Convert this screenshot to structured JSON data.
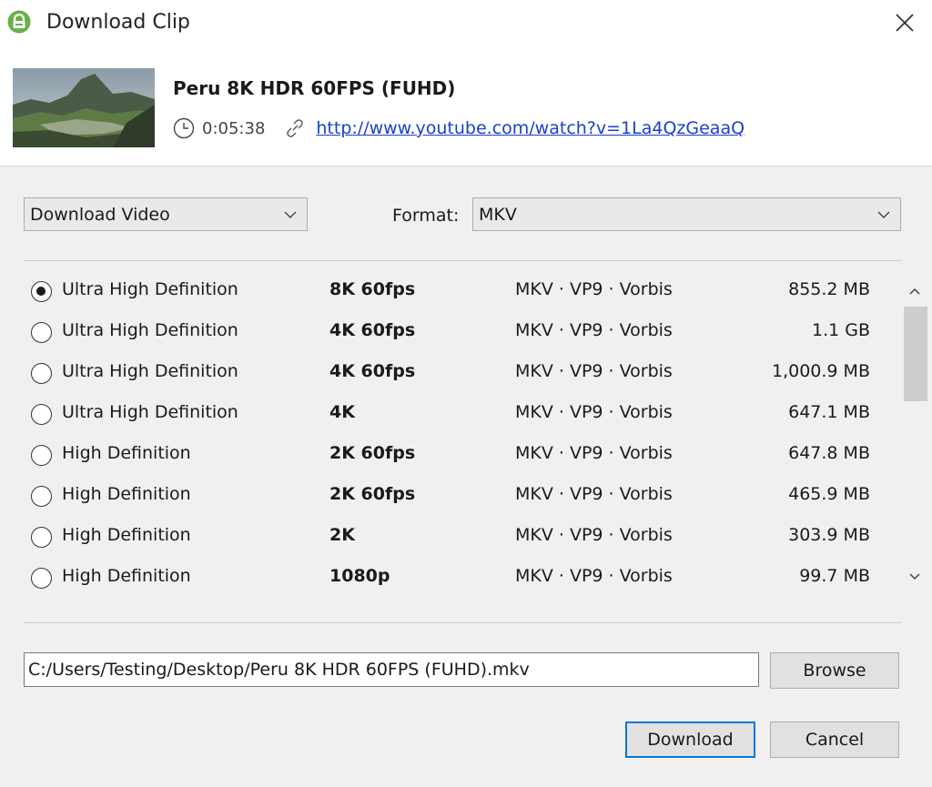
{
  "window": {
    "title": "Download Clip"
  },
  "video": {
    "title": "Peru 8K HDR 60FPS (FUHD)",
    "duration": "0:05:38",
    "url": "http://www.youtube.com/watch?v=1La4QzGeaaQ"
  },
  "controls": {
    "mode_selected": "Download Video",
    "format_label": "Format:",
    "format_selected": "MKV"
  },
  "streams": [
    {
      "quality": "Ultra High Definition",
      "resolution": "8K 60fps",
      "codec": "MKV · VP9 · Vorbis",
      "size": "855.2 MB",
      "selected": true
    },
    {
      "quality": "Ultra High Definition",
      "resolution": "4K 60fps",
      "codec": "MKV · VP9 · Vorbis",
      "size": "1.1 GB",
      "selected": false
    },
    {
      "quality": "Ultra High Definition",
      "resolution": "4K 60fps",
      "codec": "MKV · VP9 · Vorbis",
      "size": "1,000.9 MB",
      "selected": false
    },
    {
      "quality": "Ultra High Definition",
      "resolution": "4K",
      "codec": "MKV · VP9 · Vorbis",
      "size": "647.1 MB",
      "selected": false
    },
    {
      "quality": "High Definition",
      "resolution": "2K 60fps",
      "codec": "MKV · VP9 · Vorbis",
      "size": "647.8 MB",
      "selected": false
    },
    {
      "quality": "High Definition",
      "resolution": "2K 60fps",
      "codec": "MKV · VP9 · Vorbis",
      "size": "465.9 MB",
      "selected": false
    },
    {
      "quality": "High Definition",
      "resolution": "2K",
      "codec": "MKV · VP9 · Vorbis",
      "size": "303.9 MB",
      "selected": false
    },
    {
      "quality": "High Definition",
      "resolution": "1080p",
      "codec": "MKV · VP9 · Vorbis",
      "size": "99.7 MB",
      "selected": false
    }
  ],
  "output": {
    "path": "C:/Users/Testing/Desktop/Peru 8K HDR 60FPS (FUHD).mkv",
    "browse_label": "Browse"
  },
  "actions": {
    "download_label": "Download",
    "cancel_label": "Cancel"
  },
  "colors": {
    "app_icon": "#6ab04c",
    "link": "#1a3fcf",
    "primary_border": "#0078d7"
  }
}
